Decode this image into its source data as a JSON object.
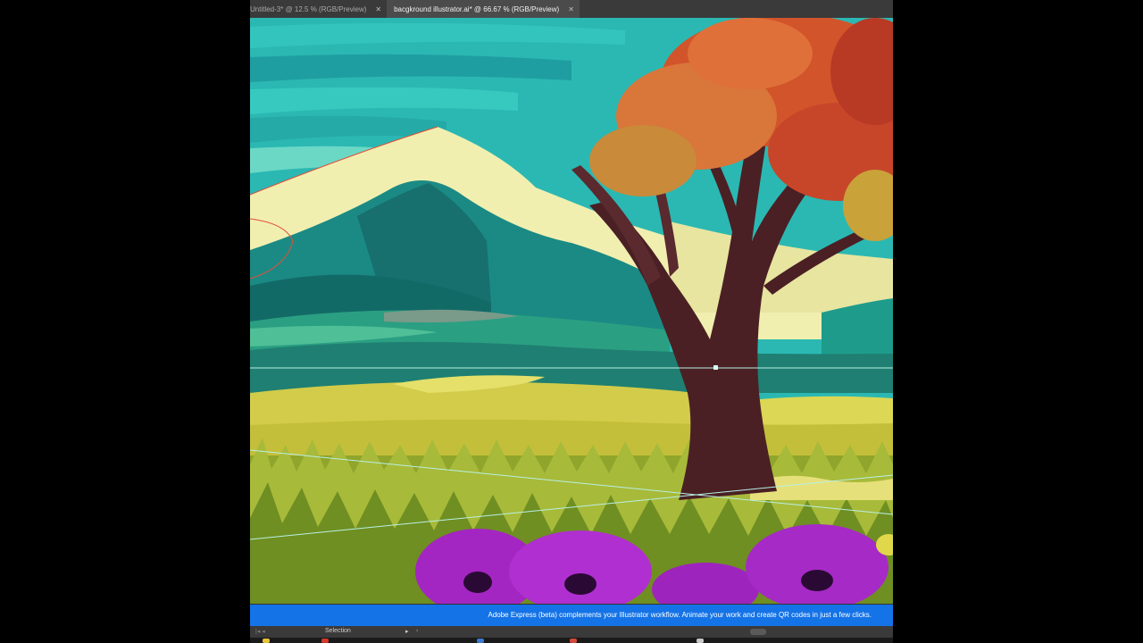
{
  "tabs": [
    {
      "label": "Untitled-3* @ 12.5 % (RGB/Preview)",
      "active": false
    },
    {
      "label": "bacgkround illustrator.ai* @ 66.67 % (RGB/Preview)",
      "active": true
    }
  ],
  "icons": {
    "close": "close-icon"
  },
  "banner": {
    "text": "Adobe Express (beta) complements your Illustrator workflow. Animate your work and create QR codes in just a few clicks."
  },
  "statusbar": {
    "tool": "Selection",
    "nav": "|◂ ◂",
    "arrow": "▸",
    "arrow2": "‹"
  },
  "colors": {
    "banner": "#1473e6",
    "sky": "#29b6b2",
    "grass": "#c9c640",
    "flower": "#a32bc4"
  }
}
